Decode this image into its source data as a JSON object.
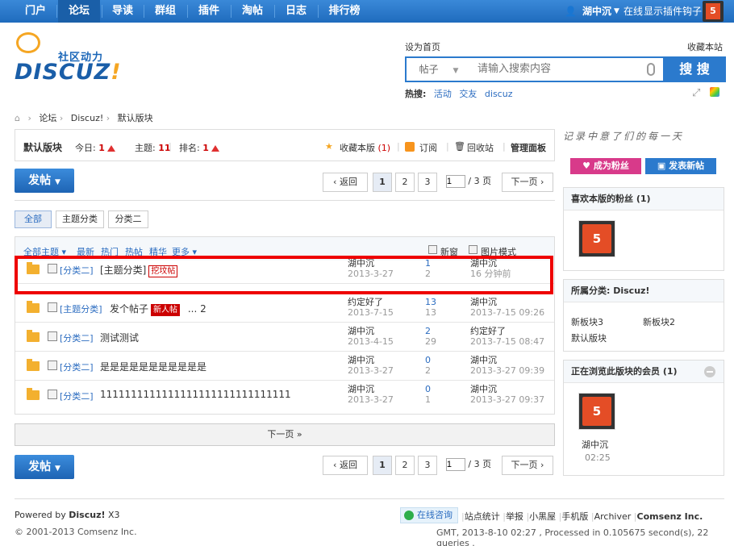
{
  "topnav": {
    "items": [
      "门户",
      "论坛",
      "导读",
      "群组",
      "插件",
      "淘帖",
      "日志",
      "排行榜"
    ],
    "username": "湖中沉",
    "status": "在线",
    "show_plugin": "显示插件钩子"
  },
  "header": {
    "logo_sub": "社区动力",
    "logo_main": "DISCUZ",
    "set_home": "设为首页",
    "bookmark": "收藏本站",
    "search_scope": "帖子",
    "search_placeholder": "请输入搜索内容",
    "search_button": "搜 搜",
    "hot_label": "热搜:",
    "hot_terms": [
      "活动",
      "交友",
      "discuz"
    ]
  },
  "breadcrumb": [
    "论坛",
    "Discuz!",
    "默认版块"
  ],
  "forum_info": {
    "name": "默认版块",
    "today_label": "今日:",
    "today": "1",
    "threads_label": "主题:",
    "threads": "11",
    "rank_label": "排名:",
    "rank": "1",
    "favorite": "收藏本版",
    "favorite_count": "(1)",
    "subscribe": "订阅",
    "recycle": "回收站",
    "manage": "管理面板"
  },
  "post_button": "发帖",
  "pager": {
    "back": "返回",
    "pages": [
      "1",
      "2",
      "3"
    ],
    "input": "1",
    "total": "/ 3 页",
    "next": "下一页"
  },
  "tabs": [
    "全部",
    "主题分类",
    "分类二"
  ],
  "list_header": {
    "all": "全部主题",
    "filters": [
      "最新",
      "热门",
      "热帖",
      "精华",
      "更多"
    ],
    "new_window": "新窗",
    "image_mode": "图片模式"
  },
  "threads": [
    {
      "category": "[分类二]",
      "title": "[主题分类]",
      "tag": "挖坟帖",
      "author": "湖中沉",
      "date": "2013-3-27",
      "replies": "1",
      "views": "2",
      "last_user": "湖中沉",
      "last_time": "16 分钟前"
    },
    {
      "category": "[主题分类]",
      "title": "发个帖子",
      "tag": "新人帖",
      "extra": "... 2",
      "author": "约定好了",
      "date": "2013-7-15",
      "replies": "13",
      "views": "13",
      "last_user": "湖中沉",
      "last_time": "2013-7-15 09:26"
    },
    {
      "category": "[分类二]",
      "title": "测试测试",
      "author": "湖中沉",
      "date": "2013-4-15",
      "replies": "2",
      "views": "29",
      "last_user": "约定好了",
      "last_time": "2013-7-15 08:47"
    },
    {
      "category": "[分类二]",
      "title": "是是是是是是是是是是是",
      "author": "湖中沉",
      "date": "2013-3-27",
      "replies": "0",
      "views": "2",
      "last_user": "湖中沉",
      "last_time": "2013-3-27 09:39"
    },
    {
      "category": "[分类二]",
      "title": "1111111111111111111111111111111",
      "author": "湖中沉",
      "date": "2013-3-27",
      "replies": "0",
      "views": "1",
      "last_user": "湖中沉",
      "last_time": "2013-3-27 09:37"
    }
  ],
  "next_page": "下一页 »",
  "sidebar": {
    "handwriting": "记录中意了们的每一天",
    "fan_btn": "成为粉丝",
    "new_post_btn": "发表新帖",
    "fans_title": "喜欢本版的粉丝 (1)",
    "category_title": "所属分类: Discuz!",
    "categories": [
      "新板块3",
      "新板块2",
      "默认版块"
    ],
    "browsing_title": "正在浏览此版块的会员 (1)",
    "browsing_user": "湖中沉",
    "browsing_time": "02:25"
  },
  "footer": {
    "powered": "Powered by",
    "brand": "Discuz!",
    "version": "X3",
    "copyright": "© 2001-2013 Comsenz Inc.",
    "online": "在线咨询",
    "links": [
      "站点统计",
      "举报",
      "小黑屋",
      "手机版",
      "Archiver"
    ],
    "company": "Comsenz Inc.",
    "gmt": "GMT, 2013-8-10 02:27 , Processed in 0.105675 second(s), 22 queries ."
  },
  "colors": {
    "nav": "#2b7acd",
    "accent_red": "#cc0000",
    "highlight": "#ee0000"
  }
}
